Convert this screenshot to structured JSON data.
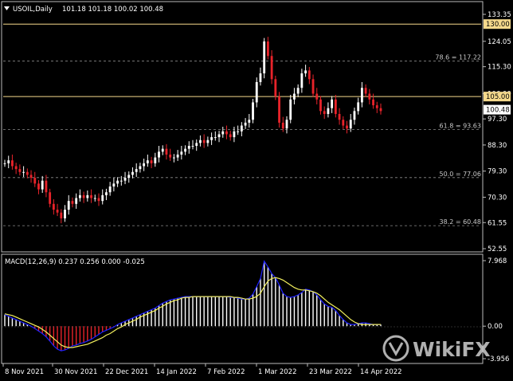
{
  "header": {
    "symbol": "USOIL,Daily",
    "ohlc": "101.18 101.18 100.02 100.48"
  },
  "indicator": {
    "label": "MACD(12,26,9) 0.237 0.256 0.000 -0.025"
  },
  "watermark": "WikiFX",
  "colors": {
    "background": "#000000",
    "bull": "#ffffff",
    "bear": "#e8232a",
    "hline": "#f5d98c",
    "dashed": "#8c8c8c",
    "macd_line": "#1e22ff",
    "signal_line": "#f3f05e",
    "current_price_tag": "#ffffff"
  },
  "price_axis": {
    "ticks": [
      "133.35",
      "124.05",
      "115.30",
      "106.00",
      "97.30",
      "88.30",
      "79.30",
      "70.30",
      "61.55",
      "52.55"
    ],
    "min": 52.55,
    "max": 133.35,
    "tags": [
      {
        "value": 130.0,
        "label": "130.00",
        "style": "highlight"
      },
      {
        "value": 105.0,
        "label": "105.00",
        "style": "highlight"
      },
      {
        "value": 100.48,
        "label": "100.48",
        "style": "current"
      }
    ]
  },
  "fibo": [
    {
      "value": 117.22,
      "label": "78.6 = 117.22"
    },
    {
      "value": 93.63,
      "label": "61.8 = 93.63"
    },
    {
      "value": 77.06,
      "label": "50.0 = 77.06"
    },
    {
      "value": 60.48,
      "label": "38.2 = 60.48"
    }
  ],
  "hlines": [
    130.0,
    105.0
  ],
  "time_axis": [
    "8 Nov 2021",
    "30 Nov 2021",
    "22 Dec 2021",
    "14 Jan 2022",
    "7 Feb 2022",
    "1 Mar 2022",
    "23 Mar 2022",
    "14 Apr 2022"
  ],
  "macd_axis": {
    "ticks": [
      "7.968",
      "0.00",
      "-3.956"
    ],
    "min": -3.956,
    "max": 7.968
  },
  "chart_data": {
    "type": "candlestick",
    "close": [
      82,
      83,
      81,
      80,
      79,
      79,
      78,
      77,
      75,
      73,
      76,
      72,
      68,
      66,
      65,
      63,
      66,
      69,
      68,
      70,
      71,
      70,
      71,
      70,
      70,
      69,
      71,
      72,
      74,
      75,
      76,
      76,
      77,
      78,
      79,
      80,
      81,
      82,
      83,
      82,
      84,
      86,
      87,
      85,
      84,
      84,
      85,
      86,
      87,
      88,
      88,
      89,
      90,
      89,
      90,
      91,
      91,
      92,
      93,
      92,
      91,
      93,
      93,
      95,
      96,
      97,
      103,
      110,
      113,
      124,
      119,
      111,
      105,
      96,
      94,
      97,
      104,
      106,
      108,
      113,
      114,
      111,
      106,
      104,
      100,
      99,
      101,
      104,
      99,
      97,
      95,
      94,
      97,
      100,
      103,
      108,
      106,
      104,
      102,
      101,
      100
    ],
    "macd": [
      1.4,
      1.2,
      1.0,
      0.8,
      0.6,
      0.4,
      0.2,
      0.0,
      -0.3,
      -0.6,
      -0.9,
      -1.3,
      -1.8,
      -2.4,
      -2.8,
      -3.0,
      -2.9,
      -2.7,
      -2.4,
      -2.3,
      -2.1,
      -2.0,
      -1.8,
      -1.6,
      -1.3,
      -1.0,
      -0.7,
      -0.5,
      -0.3,
      -0.1,
      0.2,
      0.4,
      0.6,
      0.8,
      1.0,
      1.2,
      1.4,
      1.6,
      1.8,
      2.0,
      2.2,
      2.5,
      2.8,
      3.0,
      3.2,
      3.3,
      3.4,
      3.5,
      3.6,
      3.6,
      3.6,
      3.6,
      3.6,
      3.6,
      3.6,
      3.6,
      3.6,
      3.6,
      3.6,
      3.6,
      3.5,
      3.5,
      3.4,
      3.3,
      3.3,
      3.4,
      3.9,
      4.8,
      5.8,
      7.9,
      7.2,
      6.4,
      5.9,
      5.0,
      4.0,
      3.6,
      3.5,
      3.6,
      3.8,
      4.1,
      4.5,
      4.4,
      4.2,
      3.8,
      3.2,
      2.7,
      2.4,
      2.3,
      1.9,
      1.3,
      0.8,
      0.4,
      0.2,
      0.2,
      0.3,
      0.4,
      0.4,
      0.3,
      0.2,
      0.2,
      0.2
    ],
    "signal": [
      1.5,
      1.4,
      1.3,
      1.1,
      0.9,
      0.7,
      0.5,
      0.3,
      0.1,
      -0.1,
      -0.4,
      -0.7,
      -1.1,
      -1.5,
      -1.9,
      -2.3,
      -2.5,
      -2.6,
      -2.6,
      -2.5,
      -2.4,
      -2.3,
      -2.2,
      -2.0,
      -1.8,
      -1.6,
      -1.4,
      -1.1,
      -0.9,
      -0.6,
      -0.3,
      -0.1,
      0.2,
      0.4,
      0.6,
      0.8,
      1.1,
      1.3,
      1.5,
      1.7,
      1.9,
      2.2,
      2.4,
      2.7,
      2.9,
      3.1,
      3.2,
      3.4,
      3.5,
      3.5,
      3.6,
      3.6,
      3.6,
      3.6,
      3.6,
      3.6,
      3.6,
      3.6,
      3.6,
      3.6,
      3.6,
      3.5,
      3.5,
      3.4,
      3.3,
      3.3,
      3.4,
      3.6,
      4.0,
      4.8,
      5.5,
      5.8,
      5.9,
      5.8,
      5.6,
      5.3,
      5.0,
      4.7,
      4.5,
      4.4,
      4.4,
      4.3,
      4.2,
      4.0,
      3.7,
      3.3,
      2.9,
      2.6,
      2.3,
      2.0,
      1.6,
      1.2,
      0.8,
      0.5,
      0.3,
      0.2,
      0.2,
      0.2,
      0.2,
      0.2,
      0.2
    ]
  }
}
